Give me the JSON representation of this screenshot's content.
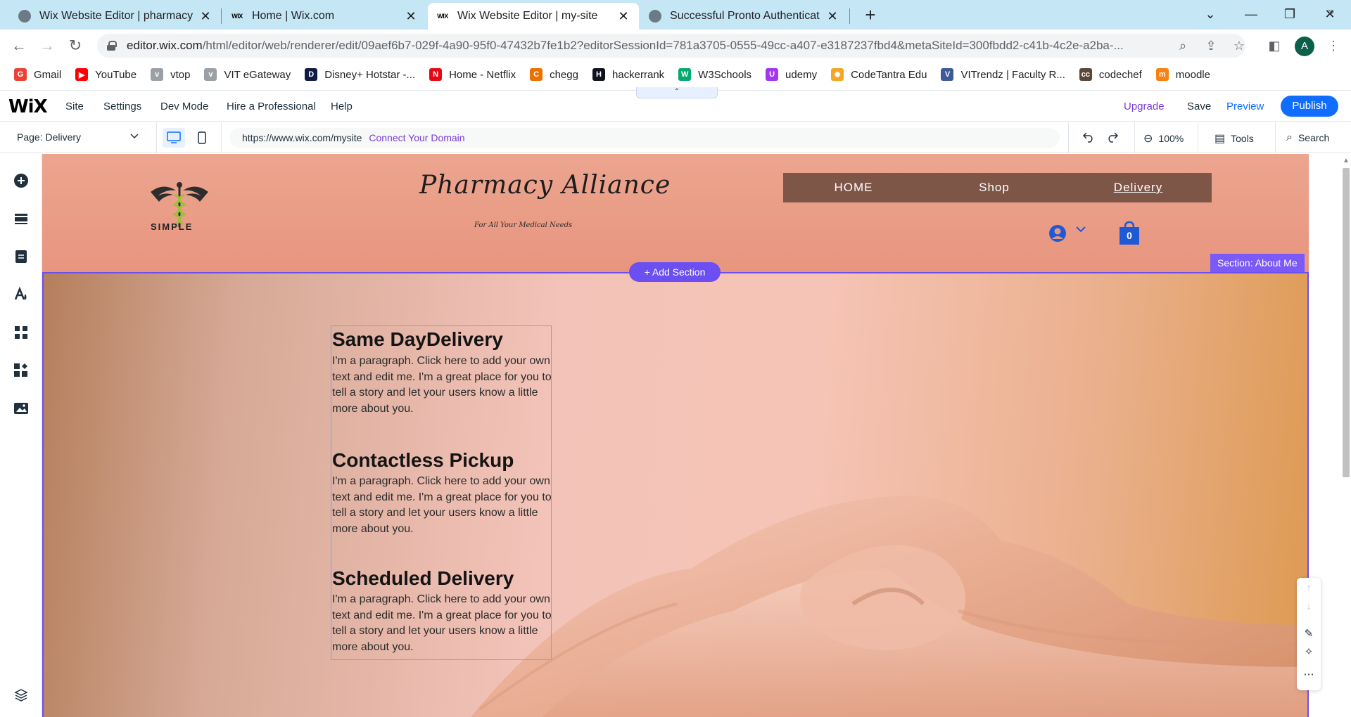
{
  "browser": {
    "tabs": [
      {
        "title": "Wix Website Editor | pharmacy-a",
        "icon": "globe-icon",
        "active": false
      },
      {
        "title": "Home | Wix.com",
        "icon": "wix-icon",
        "active": false
      },
      {
        "title": "Wix Website Editor | my-site",
        "icon": "wix-icon",
        "active": true
      },
      {
        "title": "Successful Pronto Authentication",
        "icon": "globe-icon",
        "active": false
      }
    ],
    "url_host": "editor.wix.com",
    "url_path": "/html/editor/web/renderer/edit/09aef6b7-029f-4a90-95f0-47432b7fe1b2?editorSessionId=781a3705-0555-49cc-a407-e3187237fbd4&metaSiteId=300fbdd2-c41b-4c2e-a2ba-...",
    "profile_initial": "A",
    "bookmarks": [
      {
        "label": "Gmail",
        "color": "#ea4335",
        "glyph": "G"
      },
      {
        "label": "YouTube",
        "color": "#ff0000",
        "glyph": "▶"
      },
      {
        "label": "vtop",
        "color": "#9aa0a6",
        "glyph": "v"
      },
      {
        "label": "VIT eGateway",
        "color": "#9aa0a6",
        "glyph": "v"
      },
      {
        "label": "Disney+ Hotstar -...",
        "color": "#0f1b44",
        "glyph": "D"
      },
      {
        "label": "Home - Netflix",
        "color": "#e50914",
        "glyph": "N"
      },
      {
        "label": "chegg",
        "color": "#eb7100",
        "glyph": "C"
      },
      {
        "label": "hackerrank",
        "color": "#0e141e",
        "glyph": "H"
      },
      {
        "label": "W3Schools",
        "color": "#04aa6d",
        "glyph": "W"
      },
      {
        "label": "udemy",
        "color": "#a435f0",
        "glyph": "U"
      },
      {
        "label": "CodeTantra Edu",
        "color": "#f5a623",
        "glyph": "✹"
      },
      {
        "label": "VITrendz | Faculty R...",
        "color": "#3d5a99",
        "glyph": "V"
      },
      {
        "label": "codechef",
        "color": "#5b4638",
        "glyph": "cc"
      },
      {
        "label": "moodle",
        "color": "#f98012",
        "glyph": "m"
      }
    ]
  },
  "wix": {
    "menu": [
      "Site",
      "Settings",
      "Dev Mode",
      "Hire a Professional",
      "Help"
    ],
    "upgrade": "Upgrade",
    "save": "Save",
    "preview": "Preview",
    "publish": "Publish",
    "page_selector": "Page: Delivery",
    "site_url": "https://www.wix.com/mysite",
    "connect_domain": "Connect Your Domain",
    "zoom": "100%",
    "tools": "Tools",
    "search": "Search",
    "colors": {
      "accent": "#116dff",
      "upgrade": "#7a3bd6",
      "section": "#6c4ff0"
    }
  },
  "site": {
    "logo_text": "SIMPLE",
    "title": "Pharmacy Alliance",
    "tagline": "For All Your Medical Needs",
    "nav": [
      "HOME",
      "Shop",
      "Delivery"
    ],
    "cart_count": "0",
    "section_label": "Section: About Me",
    "add_section": "+ Add Section",
    "blocks": [
      {
        "heading": "Same DayDelivery",
        "body": "I'm a paragraph. Click here to add your own text and edit me. I'm a great place for you to tell a story and let your users know a little more about you."
      },
      {
        "heading": "Contactless Pickup",
        "body": "I'm a paragraph. Click here to add your own text and edit me. I'm a great place for you to tell a story and let your users know a little more about you."
      },
      {
        "heading": "Scheduled Delivery",
        "body": "I'm a paragraph. Click here to add your own text and edit me. I'm a great place for you to tell a story and let your users know a little more about you."
      }
    ],
    "colors": {
      "nav_bg": "#7e5648",
      "header_bg": "#eca58f"
    }
  }
}
